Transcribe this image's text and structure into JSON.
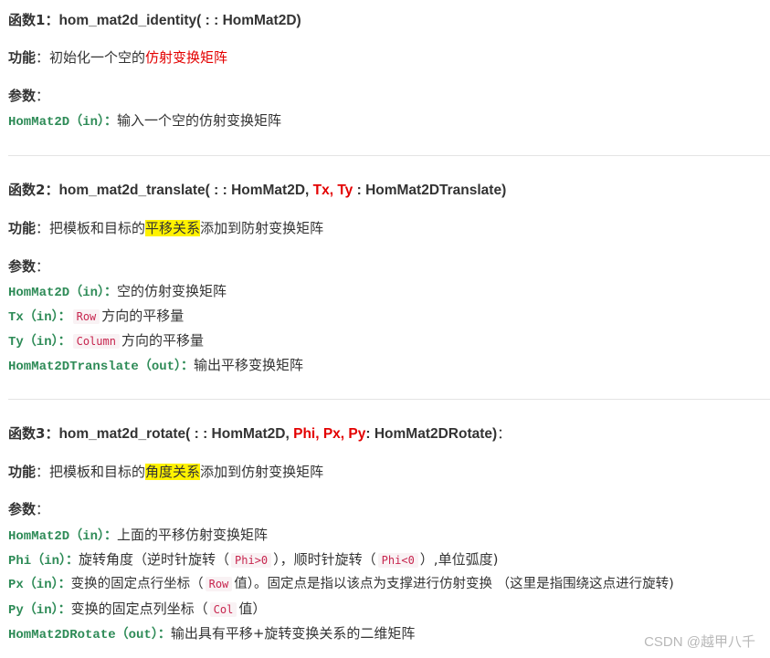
{
  "sections": [
    {
      "heading_prefix": "函数1",
      "heading_sep": "：",
      "heading_text": "hom_mat2d_identity( : : HomMat2D)",
      "function_label": "功能",
      "function_sep": "：",
      "function_text": "初始化一个空的",
      "function_red": "仿射变换矩阵",
      "params_label": "参数",
      "params_sep": "：",
      "params": [
        {
          "name": "HomMat2D（in）：",
          "desc": "输入一个空的仿射变换矩阵"
        }
      ]
    },
    {
      "heading_prefix": "函数2",
      "heading_sep": "：",
      "heading_text_a": "hom_mat2d_translate( : : HomMat2D, ",
      "heading_red": "Tx, Ty",
      "heading_text_b": " : HomMat2DTranslate)",
      "function_label": "功能",
      "function_sep": "：",
      "function_text_a": "把模板和目标的",
      "function_highlight": "平移关系",
      "function_text_b": "添加到防射变换矩阵",
      "params_label": "参数",
      "params_sep": "：",
      "params": [
        {
          "name": "HomMat2D（in）：",
          "desc_a": "空的仿射变换矩阵"
        },
        {
          "name": "Tx（in）：",
          "code": "Row",
          "desc_b": "方向的平移量"
        },
        {
          "name": "Ty（in）：",
          "code": "Column",
          "desc_b": "方向的平移量"
        },
        {
          "name": "HomMat2DTranslate（out）：",
          "desc_a": "输出平移变换矩阵"
        }
      ]
    },
    {
      "heading_prefix": "函数3",
      "heading_sep": "：",
      "heading_text_a": "hom_mat2d_rotate( : : HomMat2D, ",
      "heading_red": "Phi, Px, Py",
      "heading_text_b": ": HomMat2DRotate)",
      "heading_tail": "：",
      "function_label": "功能",
      "function_sep": "：",
      "function_text_a": "把模板和目标的",
      "function_highlight": "角度关系",
      "function_text_b": "添加到仿射变换矩阵",
      "params_label": "参数",
      "params_sep": "：",
      "params": [
        {
          "name": "HomMat2D（in）：",
          "desc_a": "上面的平移仿射变换矩阵"
        },
        {
          "name": "Phi（in）：",
          "desc_a": "旋转角度（逆时针旋转（",
          "code": "Phi>0",
          "desc_b": "），顺时针旋转（",
          "code2": "Phi<0",
          "desc_c": "）,单位弧度)"
        },
        {
          "name": "Px（in）：",
          "desc_a": "变换的固定点行坐标（",
          "code": "Row",
          "desc_b": "值）。固定点是指以该点为支撑进行仿射变换 （这里是指围绕这点进行旋转)"
        },
        {
          "name": "Py（in）：",
          "desc_a": "变换的固定点列坐标（",
          "code": "Col",
          "desc_b": "值）"
        },
        {
          "name": "HomMat2DRotate（out）：",
          "desc_a": "输出具有平移+旋转变换关系的二维矩阵"
        }
      ]
    }
  ],
  "watermark": "CSDN @越甲八千",
  "colors": {
    "red": "#e30000",
    "param_green": "#2e8b57",
    "highlight": "#fff200",
    "code_text": "#c7254e",
    "code_bg": "#f9f2f4"
  }
}
